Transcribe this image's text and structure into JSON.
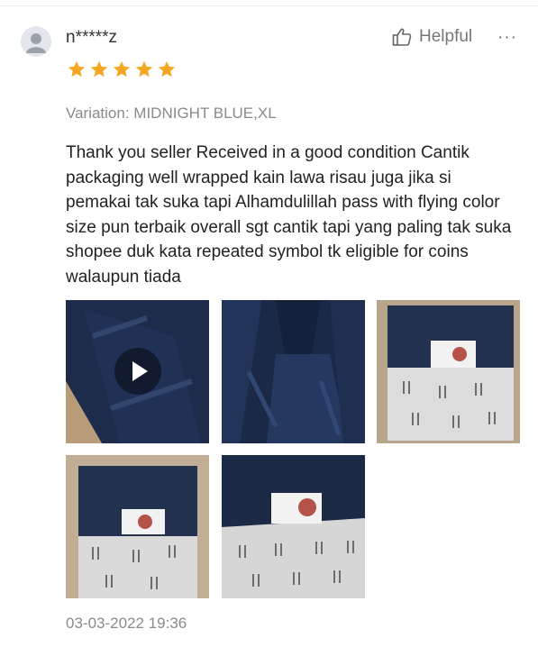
{
  "review": {
    "username": "n*****z",
    "helpful_label": "Helpful",
    "more_label": "···",
    "rating": 5,
    "variation": "Variation: MIDNIGHT BLUE,XL",
    "text": "Thank you seller Received in a good condition Cantik packaging well wrapped kain lawa risau juga jika si pemakai tak suka tapi Alhamdulillah pass with flying color size pun terbaik overall sgt cantik tapi yang paling tak suka shopee duk kata repeated symbol tk eligible for coins walaupun tiada",
    "timestamp": "03-03-2022 19:36",
    "media": [
      {
        "kind": "video",
        "subject": "navy fabric close-up"
      },
      {
        "kind": "photo",
        "subject": "navy garment laid flat"
      },
      {
        "kind": "photo",
        "subject": "packaged garment in box"
      },
      {
        "kind": "photo",
        "subject": "packaged garment in box"
      },
      {
        "kind": "photo",
        "subject": "packaged garment with tag"
      }
    ]
  },
  "colors": {
    "star": "#f5a623",
    "garment": "#1b2a47",
    "wrap": "#dcdcdc"
  }
}
